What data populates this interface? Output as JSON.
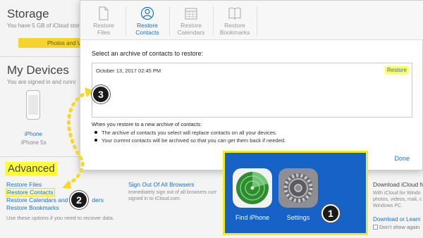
{
  "background": {
    "storage": {
      "title": "Storage",
      "subtitle": "You have 5 GB of iCloud stor",
      "bar_label": "Photos and V"
    },
    "devices": {
      "title": "My Devices",
      "subtitle": "You are signed in and runni",
      "device_name": "iPhone",
      "device_model": "iPhone 5s"
    },
    "advanced": {
      "title": "Advanced",
      "links": [
        "Restore Files",
        "Restore Contacts",
        "Restore Calendars and",
        "ders",
        "Restore Bookmarks"
      ],
      "note": "Use these options if you need to recover data."
    },
    "signout": {
      "title": "Sign Out Of All Browsers",
      "description": "Immediately sign out of all browsers curr signed in to iCloud.com."
    },
    "download": {
      "title": "Download iCloud fo",
      "description": "With iCloud for Windo photos, videos, mail, c Windows PC.",
      "link": "Download or Learn",
      "checkbox_label": "Don't show again"
    }
  },
  "modal": {
    "tabs": [
      {
        "label_line1": "Restore",
        "label_line2": "Files",
        "icon": "file-icon",
        "active": false
      },
      {
        "label_line1": "Restore",
        "label_line2": "Contacts",
        "icon": "contacts-icon",
        "active": true
      },
      {
        "label_line1": "Restore",
        "label_line2": "Calendars",
        "icon": "calendar-icon",
        "active": false
      },
      {
        "label_line1": "Restore",
        "label_line2": "Bookmarks",
        "icon": "bookmarks-icon",
        "active": false
      }
    ],
    "prompt": "Select an archive of contacts to restore:",
    "archives": [
      {
        "date": "October 13, 2017 02:45 PM",
        "action": "Restore"
      }
    ],
    "warning_title": "When you restore to a new archive of contacts:",
    "bullets": [
      "The archive of contacts you select will replace contacts on all your devices.",
      "Your current contacts will be archived so that you can get them back if needed."
    ],
    "done_label": "Done"
  },
  "steps": [
    "1",
    "2",
    "3"
  ],
  "apps": [
    {
      "label": "Find iPhone",
      "icon": "find-iphone-icon"
    },
    {
      "label": "Settings",
      "icon": "settings-gear-icon"
    }
  ],
  "colors": {
    "accent": "#1a73c9",
    "highlight": "#ffff33",
    "callout_bg": "#1762c6",
    "callout_border": "#f4ea1c"
  }
}
